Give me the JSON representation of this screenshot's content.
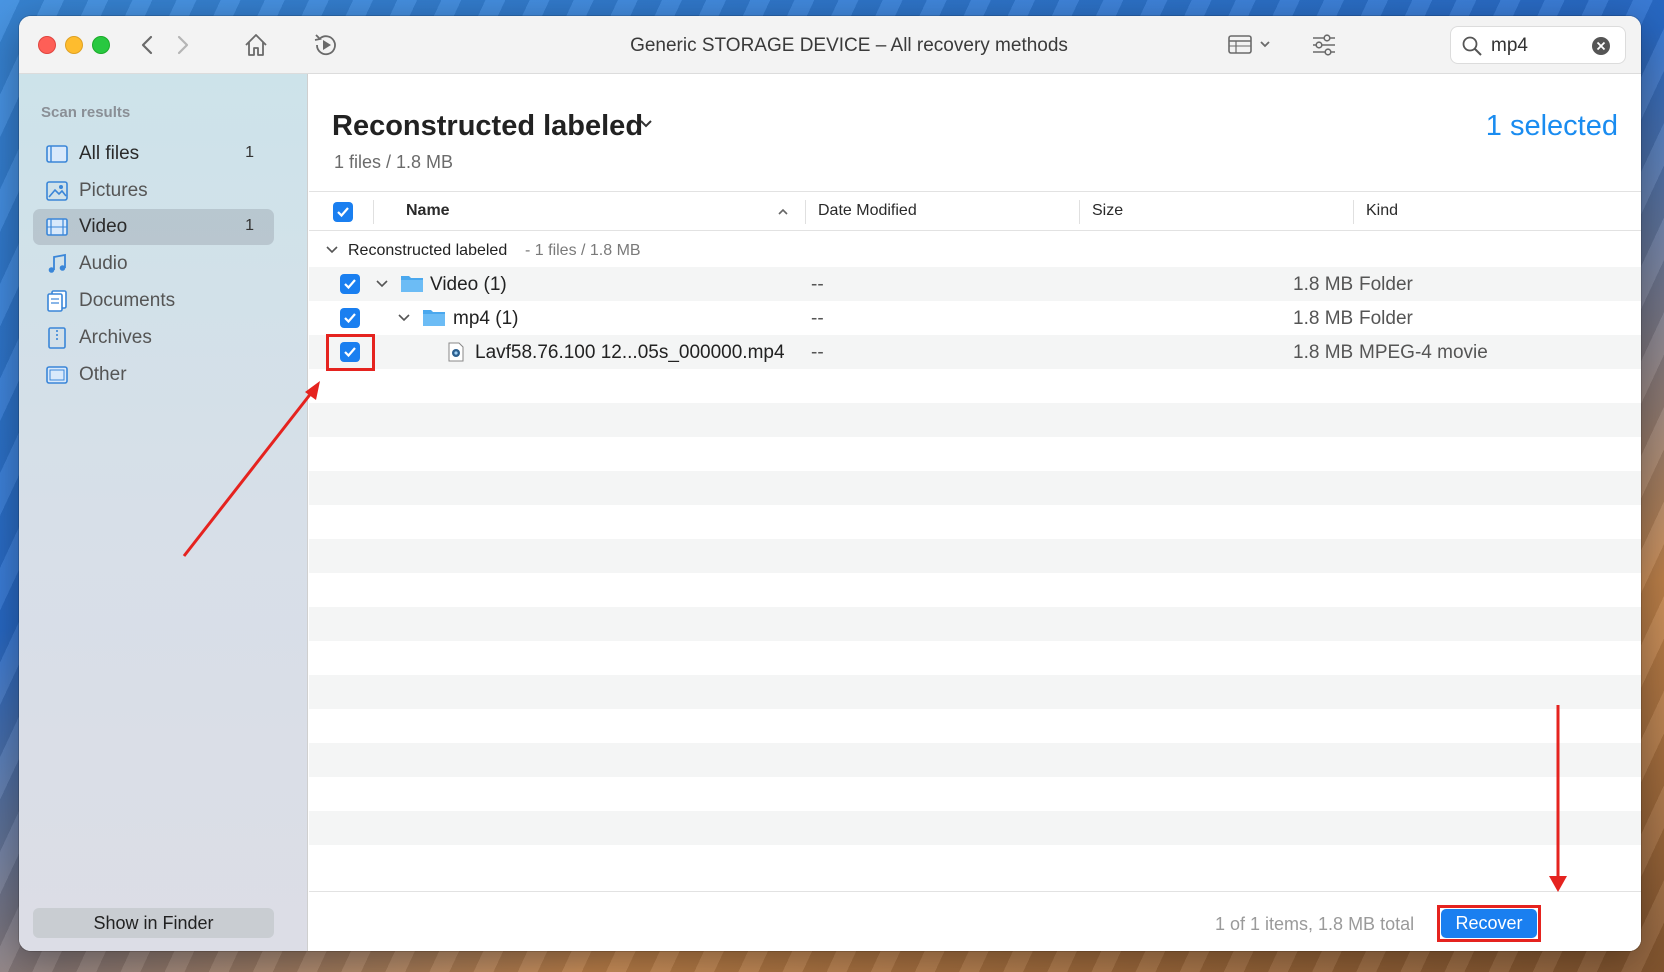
{
  "window": {
    "title": "Generic STORAGE DEVICE – All recovery methods"
  },
  "toolbar": {
    "search_value": "mp4"
  },
  "sidebar": {
    "heading": "Scan results",
    "items": [
      {
        "label": "All files",
        "count": "1",
        "icon": "all-files-icon"
      },
      {
        "label": "Pictures",
        "count": "",
        "icon": "pictures-icon"
      },
      {
        "label": "Video",
        "count": "1",
        "icon": "video-icon",
        "active": true
      },
      {
        "label": "Audio",
        "count": "",
        "icon": "audio-icon"
      },
      {
        "label": "Documents",
        "count": "",
        "icon": "documents-icon"
      },
      {
        "label": "Archives",
        "count": "",
        "icon": "archives-icon"
      },
      {
        "label": "Other",
        "count": "",
        "icon": "other-icon"
      }
    ],
    "show_in_finder": "Show in Finder"
  },
  "main": {
    "title": "Reconstructed labeled",
    "subtitle": "1 files / 1.8 MB",
    "selected": "1 selected",
    "columns": {
      "name": "Name",
      "date": "Date Modified",
      "size": "Size",
      "kind": "Kind"
    },
    "group": {
      "name": "Reconstructed labeled",
      "info": "- 1 files / 1.8 MB"
    },
    "rows": [
      {
        "name": "Video (1)",
        "date": "--",
        "size": "1.8 MB",
        "kind": "Folder",
        "checked": true
      },
      {
        "name": "mp4 (1)",
        "date": "--",
        "size": "1.8 MB",
        "kind": "Folder",
        "checked": true
      },
      {
        "name": "Lavf58.76.100 12...05s_000000.mp4",
        "date": "--",
        "size": "1.8 MB",
        "kind": "MPEG-4 movie",
        "checked": true
      }
    ]
  },
  "footer": {
    "info": "1 of 1 items, 1.8 MB total",
    "recover": "Recover"
  },
  "colors": {
    "accent": "#1a7ff0",
    "annotation": "#e5231f"
  }
}
